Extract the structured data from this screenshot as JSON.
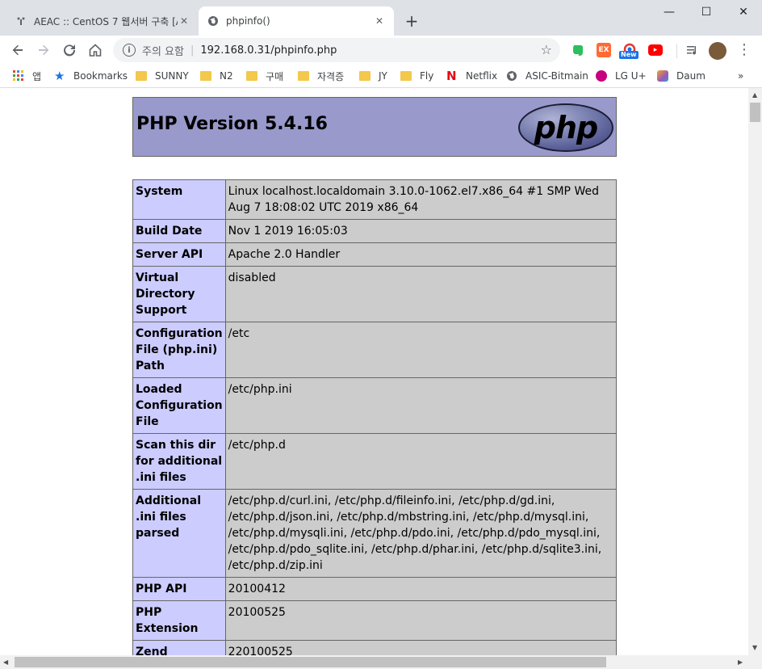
{
  "window": {
    "controls": {
      "minimize": "—",
      "maximize": "☐",
      "close": "✕"
    }
  },
  "tabs": [
    {
      "title": "AEAC :: CentOS 7 웹서버 구축 [A",
      "icon": "aeac-favicon",
      "active": false
    },
    {
      "title": "phpinfo()",
      "icon": "globe-icon",
      "active": true
    }
  ],
  "new_tab_label": "+",
  "toolbar": {
    "security_warning": "주의 요함",
    "url": "192.168.0.31/phpinfo.php",
    "extensions": [
      {
        "name": "evernote-icon",
        "color": "#2dbe60"
      },
      {
        "name": "ex-icon",
        "color": "#ff6b35",
        "label": "EX"
      },
      {
        "name": "new-extension-icon",
        "color": "#e53935",
        "badge": "New"
      },
      {
        "name": "youtube-icon",
        "color": "#ff0000"
      }
    ]
  },
  "bookmarks": [
    {
      "label": "앱",
      "icon": "apps-icon"
    },
    {
      "label": "Bookmarks",
      "icon": "star-icon"
    },
    {
      "label": "SUNNY",
      "icon": "folder-icon"
    },
    {
      "label": "N2",
      "icon": "folder-icon"
    },
    {
      "label": "구매",
      "icon": "folder-icon"
    },
    {
      "label": "자격증",
      "icon": "folder-icon"
    },
    {
      "label": "JY",
      "icon": "folder-icon"
    },
    {
      "label": "Fly",
      "icon": "folder-icon"
    },
    {
      "label": "Netflix",
      "icon": "netflix-icon"
    },
    {
      "label": "ASIC-Bitmain",
      "icon": "globe-icon"
    },
    {
      "label": "LG U+",
      "icon": "lg-icon"
    },
    {
      "label": "Daum",
      "icon": "daum-icon"
    }
  ],
  "bookmarks_overflow": "»",
  "page": {
    "title": "PHP Version 5.4.16",
    "logo_text": "php",
    "rows": [
      {
        "key": "System",
        "value": "Linux localhost.localdomain 3.10.0-1062.el7.x86_64 #1 SMP Wed Aug 7 18:08:02 UTC 2019 x86_64"
      },
      {
        "key": "Build Date",
        "value": "Nov 1 2019 16:05:03"
      },
      {
        "key": "Server API",
        "value": "Apache 2.0 Handler"
      },
      {
        "key": "Virtual Directory Support",
        "value": "disabled"
      },
      {
        "key": "Configuration File (php.ini) Path",
        "value": "/etc"
      },
      {
        "key": "Loaded Configuration File",
        "value": "/etc/php.ini"
      },
      {
        "key": "Scan this dir for additional .ini files",
        "value": "/etc/php.d"
      },
      {
        "key": "Additional .ini files parsed",
        "value": "/etc/php.d/curl.ini, /etc/php.d/fileinfo.ini, /etc/php.d/gd.ini, /etc/php.d/json.ini, /etc/php.d/mbstring.ini, /etc/php.d/mysql.ini, /etc/php.d/mysqli.ini, /etc/php.d/pdo.ini, /etc/php.d/pdo_mysql.ini, /etc/php.d/pdo_sqlite.ini, /etc/php.d/phar.ini, /etc/php.d/sqlite3.ini, /etc/php.d/zip.ini"
      },
      {
        "key": "PHP API",
        "value": "20100412"
      },
      {
        "key": "PHP Extension",
        "value": "20100525"
      },
      {
        "key": "Zend Extension",
        "value": "220100525"
      }
    ]
  }
}
